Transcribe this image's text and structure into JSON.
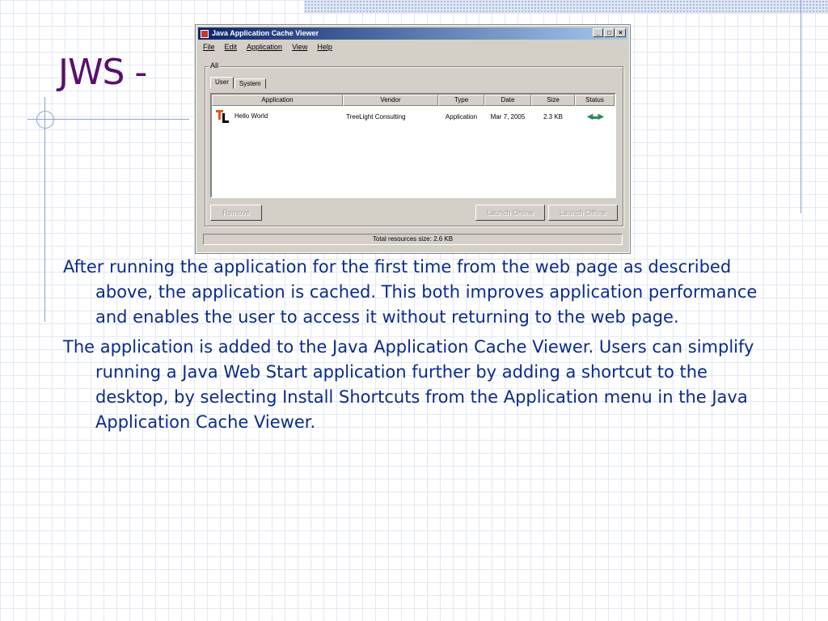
{
  "slide": {
    "title": "JWS - "
  },
  "window": {
    "title": "Java Application Cache Viewer",
    "controls": [
      "_",
      "□",
      "×"
    ],
    "menu": [
      "File",
      "Edit",
      "Application",
      "View",
      "Help"
    ],
    "group_label": "All",
    "tabs": [
      "User",
      "System"
    ],
    "columns": [
      "Application",
      "Vendor",
      "Type",
      "Date",
      "Size",
      "Status"
    ],
    "rows": [
      {
        "application": "Hello World",
        "vendor": "TreeLight Consulting",
        "type": "Application",
        "date": "Mar 7, 2005",
        "size": "2.3 KB",
        "status_icon": "online-status-icon"
      }
    ],
    "buttons": {
      "remove": "Remove",
      "launch_online": "Launch Online",
      "launch_offline": "Launch Offline"
    },
    "status_bar": "Total resources size:  2.6 KB"
  },
  "body": {
    "paragraphs": [
      "After running the application for the first time from the web page as described above, the application is cached.  This both improves application performance and enables the user to access it without returning to the web page.",
      "The application is added to the Java Application Cache Viewer. Users can simplify running a Java Web Start application further by adding a shortcut to the desktop, by selecting Install Shortcuts from the Application menu in the Java Application Cache Viewer."
    ]
  },
  "colors": {
    "title": "#5a0f6e",
    "body_text": "#0a2b8c",
    "grid": "#e3e8f4",
    "accent_line": "#8fa1cf",
    "win_title_bar": "#0a246a"
  }
}
